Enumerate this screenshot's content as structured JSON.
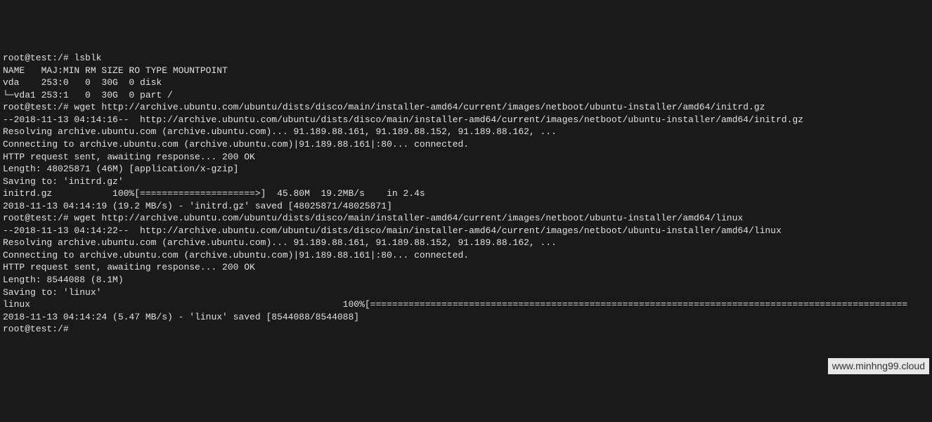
{
  "lines": [
    "root@test:/# lsblk",
    "NAME   MAJ:MIN RM SIZE RO TYPE MOUNTPOINT",
    "vda    253:0   0  30G  0 disk ",
    "└─vda1 253:1   0  30G  0 part /",
    "root@test:/# wget http://archive.ubuntu.com/ubuntu/dists/disco/main/installer-amd64/current/images/netboot/ubuntu-installer/amd64/initrd.gz",
    "--2018-11-13 04:14:16--  http://archive.ubuntu.com/ubuntu/dists/disco/main/installer-amd64/current/images/netboot/ubuntu-installer/amd64/initrd.gz",
    "Resolving archive.ubuntu.com (archive.ubuntu.com)... 91.189.88.161, 91.189.88.152, 91.189.88.162, ...",
    "Connecting to archive.ubuntu.com (archive.ubuntu.com)|91.189.88.161|:80... connected.",
    "HTTP request sent, awaiting response... 200 OK",
    "Length: 48025871 (46M) [application/x-gzip]",
    "Saving to: 'initrd.gz'",
    "",
    "initrd.gz           100%[=====================>]  45.80M  19.2MB/s    in 2.4s    ",
    "",
    "2018-11-13 04:14:19 (19.2 MB/s) - 'initrd.gz' saved [48025871/48025871]",
    "",
    "root@test:/# wget http://archive.ubuntu.com/ubuntu/dists/disco/main/installer-amd64/current/images/netboot/ubuntu-installer/amd64/linux",
    "--2018-11-13 04:14:22--  http://archive.ubuntu.com/ubuntu/dists/disco/main/installer-amd64/current/images/netboot/ubuntu-installer/amd64/linux",
    "Resolving archive.ubuntu.com (archive.ubuntu.com)... 91.189.88.161, 91.189.88.152, 91.189.88.162, ...",
    "Connecting to archive.ubuntu.com (archive.ubuntu.com)|91.189.88.161|:80... connected.",
    "HTTP request sent, awaiting response... 200 OK",
    "Length: 8544088 (8.1M)",
    "Saving to: 'linux'",
    "",
    "linux                                                         100%[==================================================================================================",
    "",
    "2018-11-13 04:14:24 (5.47 MB/s) - 'linux' saved [8544088/8544088]",
    "",
    "root@test:/# "
  ],
  "watermark": "www.minhng99.cloud"
}
